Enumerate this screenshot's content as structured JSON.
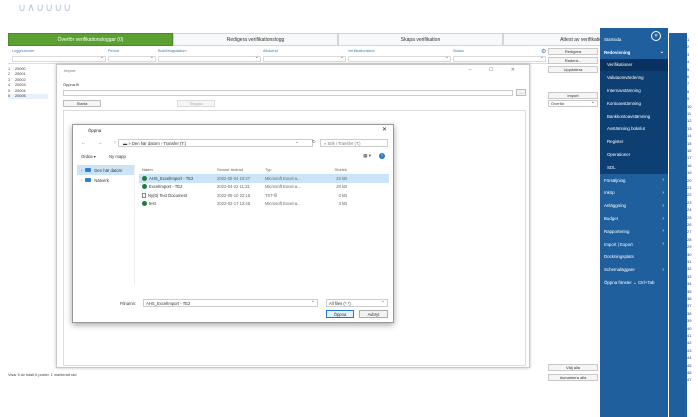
{
  "logo": "∪∧∪∪∪∪",
  "tabs": [
    "Överför verifikationsloggar (0)",
    "Redigera verifikationslogg",
    "Skapa verifikation",
    "Attest av verifikation(0)"
  ],
  "filter_columns": [
    "Loggnummer",
    "Period",
    "Bokföringsdatum",
    "Allokerat",
    "Verifikationstext",
    "Status"
  ],
  "rows": [
    {
      "n": "1",
      "id": "20000"
    },
    {
      "n": "2",
      "id": "20001"
    },
    {
      "n": "3",
      "id": "20002"
    },
    {
      "n": "4",
      "id": "20003"
    },
    {
      "n": "5",
      "id": "20004"
    },
    {
      "n": "6",
      "id": "20005"
    }
  ],
  "right_buttons": {
    "redigera": "Redigera",
    "radera": "Radera...",
    "uppdatera": "Uppdatera",
    "import": "Import",
    "overfor": "Överför",
    "valj_alla": "Välj alla",
    "avmarkera_alla": "Avmarkera alla"
  },
  "status_text": "Visar 6 av totalt 6 poster. 1 markerad rad",
  "sidebar": {
    "items": [
      {
        "label": "Startsida"
      },
      {
        "label": "Redovisning",
        "bold": true,
        "chev": "⌄"
      }
    ],
    "sub": [
      {
        "label": "Verifikationer",
        "active": true
      },
      {
        "label": "Valutaomvärdering"
      },
      {
        "label": "Internavstämning"
      },
      {
        "label": "Kontoavstämning"
      },
      {
        "label": "Bankkontoavstämning"
      },
      {
        "label": "Avstämning bokslut"
      },
      {
        "label": "Register"
      },
      {
        "label": "Operationer"
      },
      {
        "label": "SDL"
      }
    ],
    "bottom": [
      {
        "label": "Försäljning",
        "chev": "›"
      },
      {
        "label": "Inköp",
        "chev": "›"
      },
      {
        "label": "Anläggning",
        "chev": "›"
      },
      {
        "label": "Budget",
        "chev": "›"
      },
      {
        "label": "Rapportering",
        "chev": "›"
      },
      {
        "label": "Import | Export",
        "chev": "›"
      },
      {
        "label": "Dockningsplats"
      },
      {
        "label": "Schemaläggare",
        "chev": "›"
      },
      {
        "label": "Öppna fönster ⌄ Ctrl+Tab"
      }
    ]
  },
  "line_numbers": [
    "1",
    "2",
    "3",
    "4",
    "5",
    "6",
    "7",
    "8",
    "9",
    "10",
    "11",
    "12",
    "13",
    "14",
    "15",
    "16",
    "17",
    "18",
    "19",
    "20",
    "21",
    "22",
    "23",
    "24",
    "25",
    "26",
    "27",
    "28",
    "29",
    "30",
    "31",
    "32",
    "33",
    "34",
    "35",
    "36",
    "37",
    "38",
    "39",
    "40",
    "41",
    "42",
    "43",
    "44",
    "45",
    "46",
    "47"
  ],
  "import_dialog": {
    "title": "Import",
    "open_file_label": "Öppna fil",
    "dots": "...",
    "start": "Starta",
    "stop": "Stoppa"
  },
  "open_dialog": {
    "title": "Öppna",
    "nav": "← → ↑",
    "address": "▬ » Den här datorn › Transfer (T:)",
    "address_ctl": "⌄ ↻",
    "search_placeholder": "⌕  Sök i Transfer (T:)",
    "toolbar_ordna": "Ordna ▾",
    "toolbar_ny_mapp": "Ny mapp",
    "view_btn": "▦ ▾",
    "help": "?",
    "tree": [
      {
        "label": "Den här datorn",
        "selected": true
      },
      {
        "label": "Nätverk",
        "selected": false
      }
    ],
    "headers": [
      "Namn",
      "Senast ändrad",
      "Typ",
      "Storlek"
    ],
    "files": [
      {
        "name": "AHS_ExcelImport - TE2",
        "date": "2022-05-04 10:27",
        "type": "Microsoft Excel-a...",
        "size": "20 kB",
        "icon": "excel",
        "selected": true
      },
      {
        "name": "ExcelImport - TE2",
        "date": "2022-04-22 11:31",
        "type": "Microsoft Excel-a...",
        "size": "20 kB",
        "icon": "excel",
        "selected": false
      },
      {
        "name": "Ny(tt) Text Document",
        "date": "2022-05-10 22:16",
        "type": "TXT-fil",
        "size": "0 kB",
        "icon": "text",
        "selected": false
      },
      {
        "name": "test",
        "date": "2022-02-17 12:46",
        "type": "Microsoft Excel-a...",
        "size": "3 kB",
        "icon": "excel",
        "selected": false
      }
    ],
    "filename_label": "Filnamn:",
    "filename": "AHS_ExcelImport - TE2",
    "filetype": "All files (*.*)",
    "open_btn": "Öppna",
    "cancel_btn": "Avbryt"
  }
}
